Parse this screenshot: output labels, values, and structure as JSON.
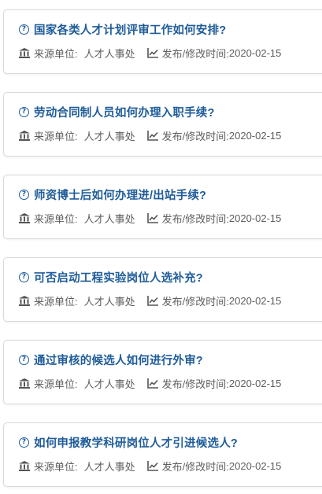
{
  "items": [
    {
      "question": "国家各类人才计划评审工作如何安排?",
      "source_label": "来源单位:",
      "source": "人才人事处",
      "date_label": "发布/修改时间:",
      "date": "2020-02-15"
    },
    {
      "question": "劳动合同制人员如何办理入职手续?",
      "source_label": "来源单位:",
      "source": "人才人事处",
      "date_label": "发布/修改时间:",
      "date": "2020-02-15"
    },
    {
      "question": "师资博士后如何办理进/出站手续?",
      "source_label": "来源单位:",
      "source": "人才人事处",
      "date_label": "发布/修改时间:",
      "date": "2020-02-15"
    },
    {
      "question": "可否启动工程实验岗位人选补充?",
      "source_label": "来源单位:",
      "source": "人才人事处",
      "date_label": "发布/修改时间:",
      "date": "2020-02-15"
    },
    {
      "question": "通过审核的候选人如何进行外审?",
      "source_label": "来源单位:",
      "source": "人才人事处",
      "date_label": "发布/修改时间:",
      "date": "2020-02-15"
    },
    {
      "question": "如何申报教学科研岗位人才引进候选人?",
      "source_label": "来源单位:",
      "source": "人才人事处",
      "date_label": "发布/修改时间:",
      "date": "2020-02-15"
    }
  ],
  "icons": {
    "question": "question-circle-icon",
    "source": "institution-icon",
    "date": "line-chart-icon"
  },
  "colors": {
    "title": "#1f5c99",
    "meta": "#5e5e5e",
    "border": "#d9d9d9"
  }
}
